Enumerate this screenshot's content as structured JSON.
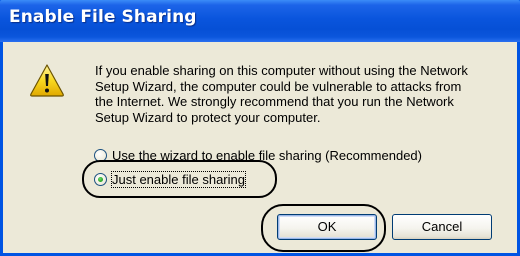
{
  "dialog": {
    "title": "Enable File Sharing",
    "icon": "warning-icon",
    "message_lines": [
      "If you enable sharing on this computer without using the Network",
      "Setup Wizard, the computer could be vulnerable to attacks from",
      "the Internet. We strongly recommend that you run the Network",
      "Setup Wizard to protect your computer."
    ],
    "options": [
      {
        "label": "Use the wizard to enable file sharing (Recommended)",
        "selected": false
      },
      {
        "label": "Just enable file sharing",
        "selected": true
      }
    ],
    "buttons": {
      "ok": "OK",
      "cancel": "Cancel"
    }
  },
  "colors": {
    "title_bar": "#0a55dd",
    "window_border": "#0054e3",
    "dialog_background": "#ece9d8",
    "button_border": "#003c74",
    "radio_selected": "#21a121",
    "warning_yellow": "#f8d820"
  }
}
